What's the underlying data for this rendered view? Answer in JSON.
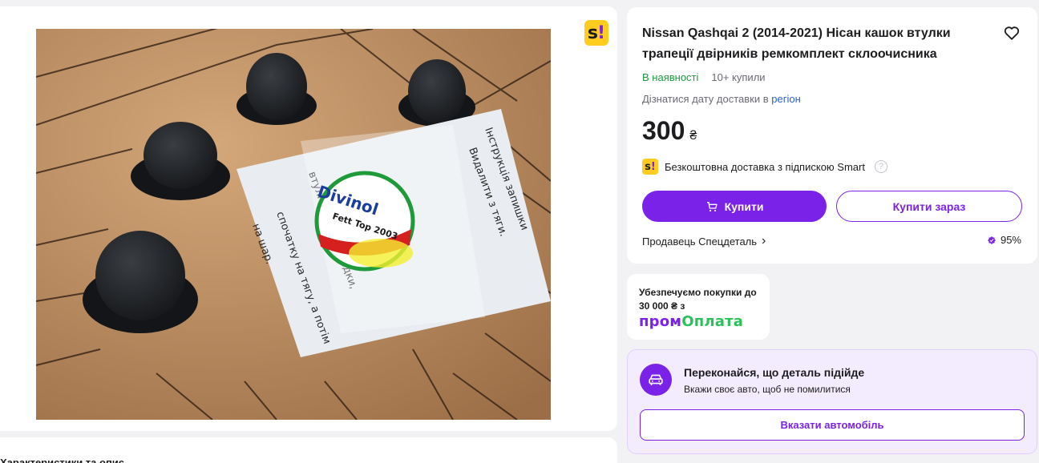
{
  "gallery": {
    "badge_letter": "s",
    "badge_mark": "!",
    "image_label_brand": "Divinol",
    "image_label_product": "Fett Top 2003",
    "image_alt": "product-photo"
  },
  "description": {
    "heading": "Характеристики та опис"
  },
  "product": {
    "title": "Nissan Qashqai 2 (2014-2021) Нісан кашок втулки трапеції двірників ремкомплект склоочисника",
    "in_stock": "В наявності",
    "bought": "10+ купили",
    "delivery_text": "Дізнатися дату доставки в",
    "delivery_link": "регіон",
    "price": "300",
    "currency": "₴",
    "smart_delivery": "Безкоштовна доставка з підпискою Smart",
    "smart_badge_letter": "s",
    "smart_badge_mark": "!",
    "help_icon": "?",
    "buy_label": "Купити",
    "buy_now_label": "Купити зараз",
    "seller": "Продавець Спецдеталь",
    "seller_chevron": "›",
    "rating": "95%"
  },
  "protection": {
    "text": "Убезпечуємо покупки до 30 000 ₴ з",
    "logo_part1": "пром",
    "logo_part2": "Оплата"
  },
  "car_check": {
    "title": "Переконайся, що деталь підійде",
    "subtitle": "Вкажи своє авто, щоб не помилитися",
    "button": "Вказати автомобіль"
  },
  "colors": {
    "accent": "#7b22e8",
    "in_stock": "#1a9a3a",
    "link": "#2a63d6",
    "smart_yellow": "#ffcc1f",
    "prom_green": "#2bc15a"
  }
}
